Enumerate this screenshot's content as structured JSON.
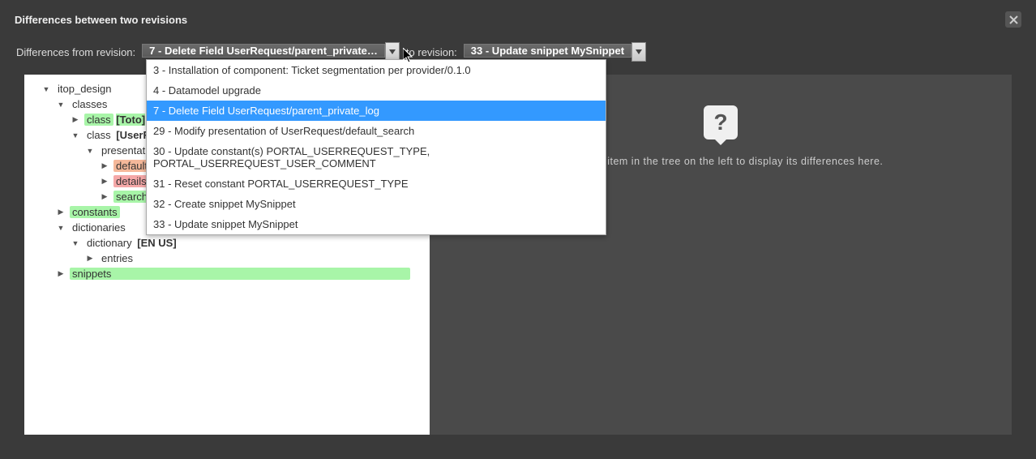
{
  "dialog": {
    "title": "Differences between two revisions"
  },
  "toolbar": {
    "from_label": "Differences from revision:",
    "to_label": "to revision:",
    "from_selected": "7 - Delete Field UserRequest/parent_private…",
    "to_selected": "33 - Update snippet MySnippet"
  },
  "dropdown": {
    "items": [
      "3 - Installation of component: Ticket segmentation per provider/0.1.0",
      "4 - Datamodel upgrade",
      "7 - Delete Field UserRequest/parent_private_log",
      "29 - Modify presentation of UserRequest/default_search",
      "30 - Update constant(s) PORTAL_USERREQUEST_TYPE, PORTAL_USERREQUEST_USER_COMMENT",
      "31 - Reset constant PORTAL_USERREQUEST_TYPE",
      "32 - Create snippet MySnippet",
      "33 - Update snippet MySnippet"
    ],
    "selected_index": 2
  },
  "tree": {
    "root": "itop_design",
    "classes_label": "classes",
    "class_toto": "class",
    "class_toto_bracket": "[Toto]",
    "class_userrequest": "class",
    "class_userrequest_bracket": "[UserRequest]",
    "presentation": "presentation",
    "default_search": "default_search",
    "details": "details",
    "search": "search",
    "constants": "constants",
    "dictionaries": "dictionaries",
    "dictionary": "dictionary",
    "dictionary_bracket": "[EN US]",
    "entries": "entries",
    "snippets": "snippets"
  },
  "diff": {
    "placeholder": "Select an item in the tree on the left to display its differences here."
  }
}
